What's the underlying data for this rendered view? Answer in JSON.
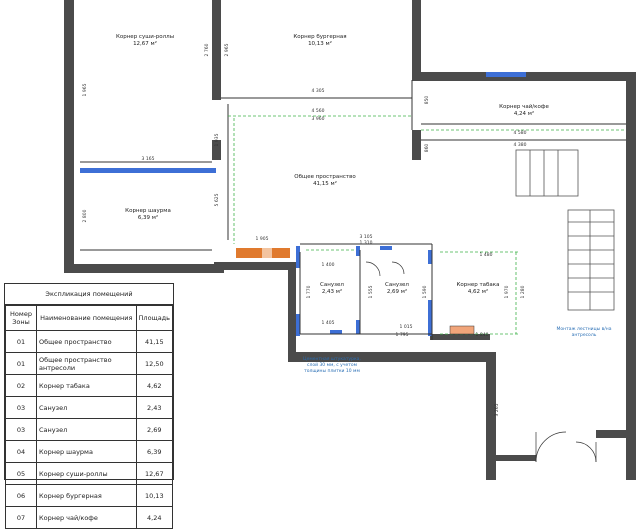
{
  "rooms": [
    {
      "name": "Корнер суши-роллы",
      "area": "12,67 м²"
    },
    {
      "name": "Корнер бургерная",
      "area": "10,13 м²"
    },
    {
      "name": "Корнер чай/кофе",
      "area": "4,24 м²"
    },
    {
      "name": "Общее пространство",
      "area": "41,15 м²"
    },
    {
      "name": "Корнер шаурма",
      "area": "6,39 м²"
    },
    {
      "name": "Санузел",
      "area": "2,43 м²"
    },
    {
      "name": "Санузел",
      "area": "2,69 м²"
    },
    {
      "name": "Корнер табака",
      "area": "4,62 м²"
    }
  ],
  "dimensions": [
    "1 965",
    "2 760",
    "2 965",
    "4 305",
    "4 560",
    "3 165",
    "3 960",
    "2 800",
    "1 935",
    "5 625",
    "1 905",
    "3 105",
    "1 310",
    "1 400",
    "1 770",
    "1 405",
    "1 015",
    "1 555",
    "1 590",
    "1 795",
    "1 970",
    "1 480",
    "1 280",
    "1 840",
    "4 580",
    "4 380",
    "850",
    "860",
    "3 265"
  ],
  "notes": {
    "partition": [
      "Цементная штукатурка,",
      "слой 30 мм, с учетом",
      "толщины плитки 10 мм"
    ],
    "stairs": [
      "Монтаж лестницы в/на",
      "антресоль"
    ]
  },
  "legend": {
    "title": "Экспликация помещений",
    "headers": [
      "Номер Зоны",
      "Наименование помещения",
      "Площадь"
    ],
    "rows": [
      {
        "num": "01",
        "name": "Общее пространство",
        "area": "41,15"
      },
      {
        "num": "01",
        "name": "Общее пространство антресоли",
        "area": "12,50"
      },
      {
        "num": "02",
        "name": "Корнер табака",
        "area": "4,62"
      },
      {
        "num": "03",
        "name": "Санузел",
        "area": "2,43"
      },
      {
        "num": "03",
        "name": "Санузел",
        "area": "2,69"
      },
      {
        "num": "04",
        "name": "Корнер шаурма",
        "area": "6,39"
      },
      {
        "num": "05",
        "name": "Корнер суши-роллы",
        "area": "12,67"
      },
      {
        "num": "06",
        "name": "Корнер бургерная",
        "area": "10,13"
      },
      {
        "num": "07",
        "name": "Корнер чай/кофе",
        "area": "4,24"
      }
    ]
  },
  "colors": {
    "wall": "#4b4b4b",
    "window": "#3d6fd6",
    "dimension_green": "#3fb24a",
    "note_blue": "#2a6fb5",
    "kitchen_orange": "#e07a2e"
  }
}
